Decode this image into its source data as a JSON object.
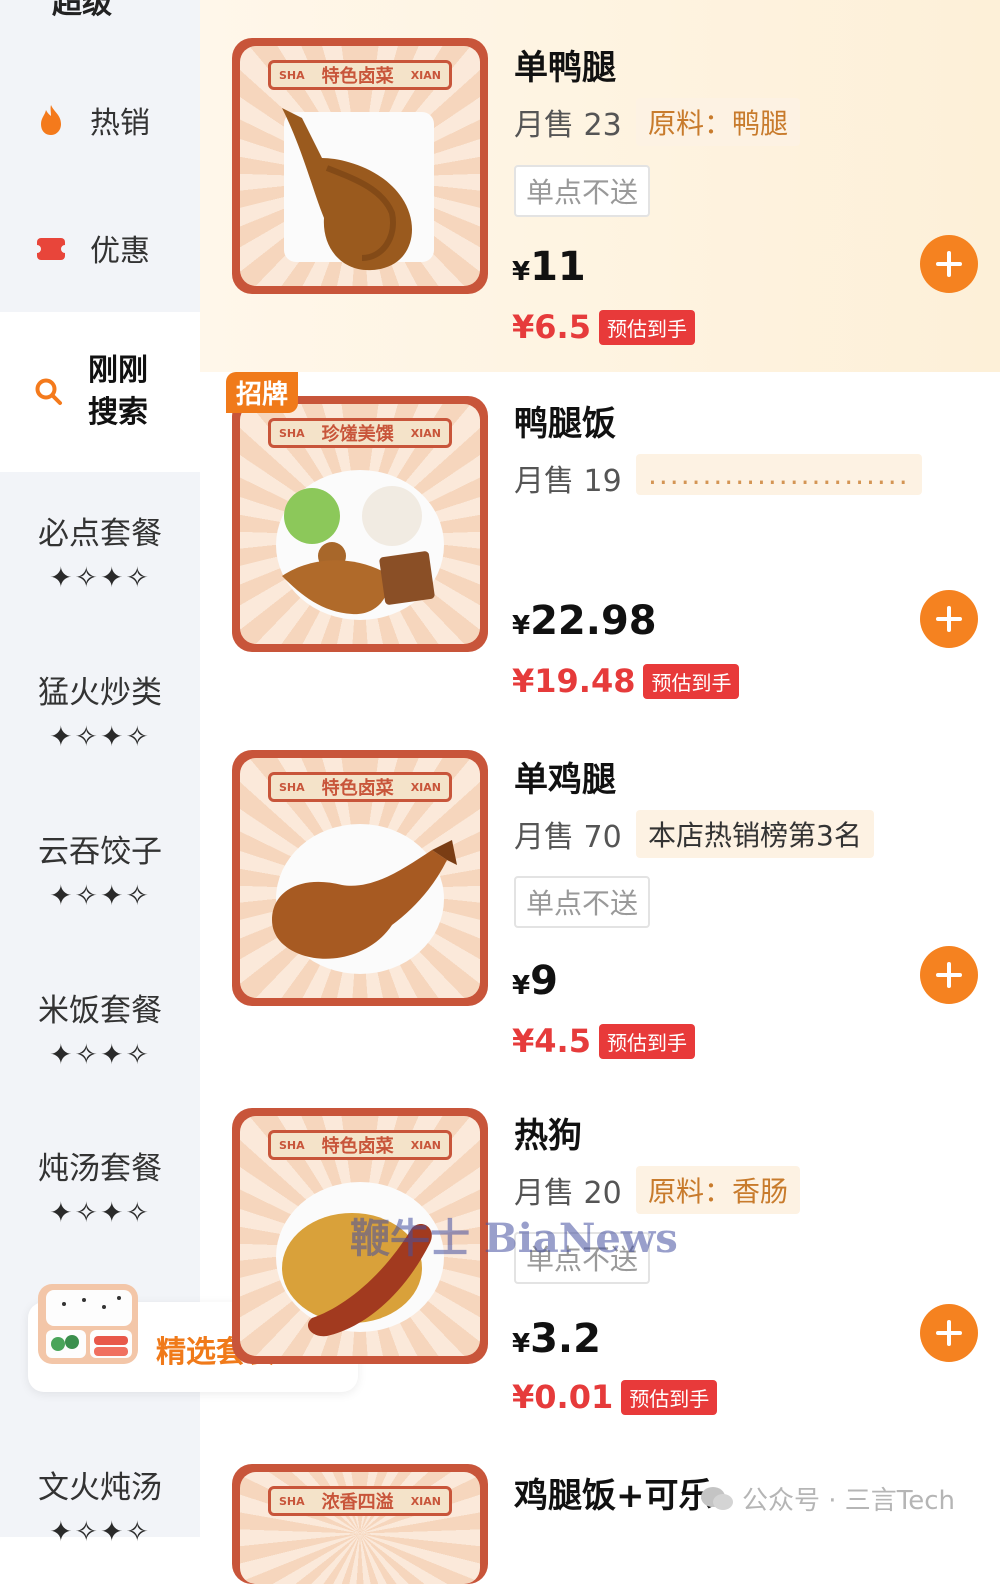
{
  "sidebar": {
    "cut_title": "超级",
    "top_items": [
      {
        "label": "热销",
        "icon": "flame-icon"
      },
      {
        "label": "优惠",
        "icon": "coupon-icon"
      }
    ],
    "active_item": {
      "label_line1": "刚刚",
      "label_line2": "搜索",
      "icon": "search-icon"
    },
    "categories": [
      {
        "name": "必点套餐",
        "stars": "✦✧✦✧"
      },
      {
        "name": "猛火炒类",
        "stars": "✦✧✦✧"
      },
      {
        "name": "云吞饺子",
        "stars": "✦✧✦✧"
      },
      {
        "name": "米饭套餐",
        "stars": "✦✧✦✧"
      },
      {
        "name": "炖汤套餐",
        "stars": "✦✧✦✧"
      },
      {
        "name": "文火炖汤",
        "stars": "✦✧✦✧"
      }
    ],
    "promo": {
      "label": "精选套餐",
      "arrow": "›",
      "icon": "bento-box-icon"
    }
  },
  "products": [
    {
      "title": "单鸭腿",
      "sales": "月售 23",
      "chip": "原料：鸭腿",
      "note": "单点不送",
      "currency": "¥",
      "price": "11",
      "est_price": "¥6.5",
      "est_label": "预估到手",
      "thumb_banner": {
        "left": "SHA",
        "center": "特色卤菜",
        "right": "XIAN"
      },
      "highlighted": true
    },
    {
      "title": "鸭腿饭",
      "sales": "月售 19",
      "chip": "........................",
      "currency": "¥",
      "price": "22.98",
      "est_price": "¥19.48",
      "est_label": "预估到手",
      "signature_tag": "招牌",
      "thumb_banner": {
        "left": "SHA",
        "center": "珍馐美馔",
        "right": "XIAN"
      }
    },
    {
      "title": "单鸡腿",
      "sales": "月售 70",
      "chip": "本店热销榜第3名",
      "note": "单点不送",
      "currency": "¥",
      "price": "9",
      "est_price": "¥4.5",
      "est_label": "预估到手",
      "thumb_banner": {
        "left": "SHA",
        "center": "特色卤菜",
        "right": "XIAN"
      }
    },
    {
      "title": "热狗",
      "sales": "月售 20",
      "chip": "原料：香肠",
      "note": "单点不送",
      "currency": "¥",
      "price": "3.2",
      "est_price": "¥0.01",
      "est_label": "预估到手",
      "thumb_banner": {
        "left": "SHA",
        "center": "特色卤菜",
        "right": "XIAN"
      }
    },
    {
      "title": "鸡腿饭+可乐",
      "thumb_banner": {
        "left": "SHA",
        "center": "浓香四溢",
        "right": "XIAN"
      }
    }
  ],
  "overlay": {
    "watermark": "鞭牛士 BiaNews",
    "wechat_label": "公众号 · 三言Tech"
  },
  "colors": {
    "accent": "#f58220",
    "price_red": "#e63b3b",
    "sidebar_bg": "#f2f4f8",
    "highlight_bg": "#fdf0d8"
  }
}
